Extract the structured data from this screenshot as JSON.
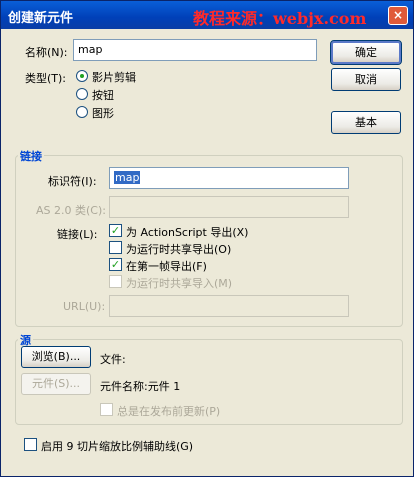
{
  "window": {
    "title": "创建新元件",
    "watermark": "教程来源：webjx.com",
    "close_glyph": "×"
  },
  "form": {
    "name_label": "名称(N):",
    "name_value": "map",
    "type_label": "类型(T):",
    "types": [
      "影片剪辑",
      "按钮",
      "图形"
    ],
    "selected_type": "影片剪辑"
  },
  "buttons": {
    "ok": "确定",
    "cancel": "取消",
    "basic": "基本"
  },
  "linkage": {
    "section_title": "链接",
    "identifier_label": "标识符(I):",
    "identifier_value": "map",
    "as2_class_label": "AS 2.0 类(C):",
    "linkage_label": "链接(L):",
    "options": [
      {
        "label": "为 ActionScript 导出(X)",
        "checked": true,
        "enabled": true
      },
      {
        "label": "为运行时共享导出(O)",
        "checked": false,
        "enabled": true
      },
      {
        "label": "在第一帧导出(F)",
        "checked": true,
        "enabled": true
      },
      {
        "label": "为运行时共享导入(M)",
        "checked": false,
        "enabled": false
      }
    ],
    "url_label": "URL(U):"
  },
  "source": {
    "section_title": "源",
    "browse_button": "浏览(B)...",
    "file_label": "文件:",
    "symbol_button": "元件(S)...",
    "symbol_name": "元件名称:元件 1",
    "always_update_label": "总是在发布前更新(P)"
  },
  "footer": {
    "nine_slice_label": "启用 9 切片缩放比例辅助线(G)"
  },
  "colors": {
    "titlebar": "#0054e3",
    "section_title": "#0046d5",
    "watermark": "#ff2a2a",
    "selection": "#316ac5"
  }
}
